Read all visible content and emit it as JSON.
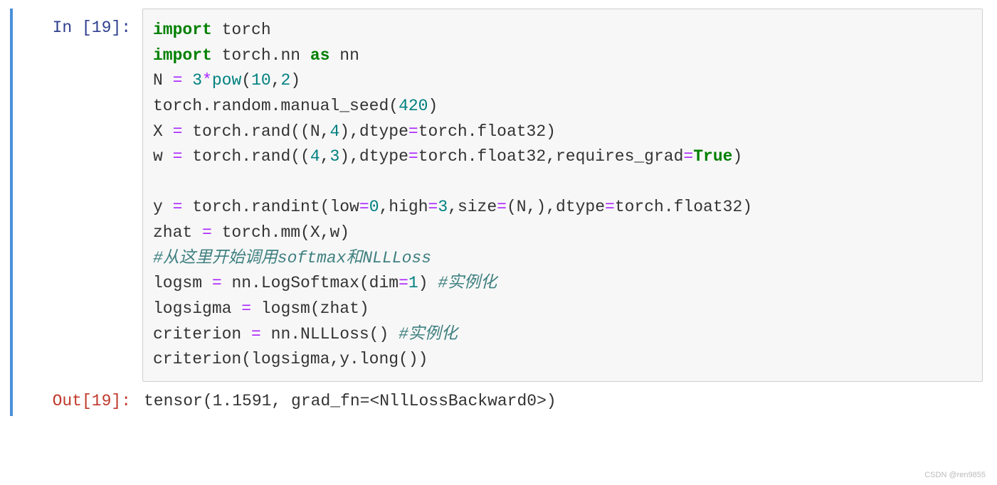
{
  "input": {
    "prompt": "In  [19]:",
    "code": {
      "l1": {
        "a": "import",
        "b": " torch"
      },
      "l2": {
        "a": "import",
        "b": " torch.nn ",
        "c": "as",
        "d": " nn"
      },
      "l3": {
        "a": "N ",
        "b": "=",
        "c": " ",
        "d": "3",
        "e": "*",
        "f": "pow",
        "g": "(",
        "h": "10",
        "i": ",",
        "j": "2",
        "k": ")"
      },
      "l4": {
        "a": "torch.random.manual_seed(",
        "b": "420",
        "c": ")"
      },
      "l5": {
        "a": "X ",
        "b": "=",
        "c": " torch.rand((N,",
        "d": "4",
        "e": "),dtype",
        "f": "=",
        "g": "torch.float32)"
      },
      "l6": {
        "a": "w ",
        "b": "=",
        "c": " torch.rand((",
        "d": "4",
        "e": ",",
        "f": "3",
        "g": "),dtype",
        "h": "=",
        "i": "torch.float32,requires_grad",
        "j": "=",
        "k": "True",
        "l": ")"
      },
      "l7": "",
      "l8": {
        "a": "y ",
        "b": "=",
        "c": " torch.randint(low",
        "d": "=",
        "e": "0",
        "f": ",high",
        "g": "=",
        "h": "3",
        "i": ",size",
        "j": "=",
        "k": "(N,),dtype",
        "l": "=",
        "m": "torch.float32)"
      },
      "l9": {
        "a": "zhat ",
        "b": "=",
        "c": " torch.mm(X,w)"
      },
      "l10": {
        "a": "#从这里开始调用softmax和NLLLoss"
      },
      "l11": {
        "a": "logsm ",
        "b": "=",
        "c": " nn.LogSoftmax(dim",
        "d": "=",
        "e": "1",
        "f": ") ",
        "g": "#实例化"
      },
      "l12": {
        "a": "logsigma ",
        "b": "=",
        "c": " logsm(zhat)"
      },
      "l13": {
        "a": "criterion ",
        "b": "=",
        "c": " nn.NLLLoss() ",
        "d": "#实例化"
      },
      "l14": {
        "a": "criterion(logsigma,y.long())"
      }
    }
  },
  "output": {
    "prompt": "Out[19]:",
    "text": "tensor(1.1591, grad_fn=<NllLossBackward0>)"
  },
  "watermark": "CSDN @ren9855"
}
